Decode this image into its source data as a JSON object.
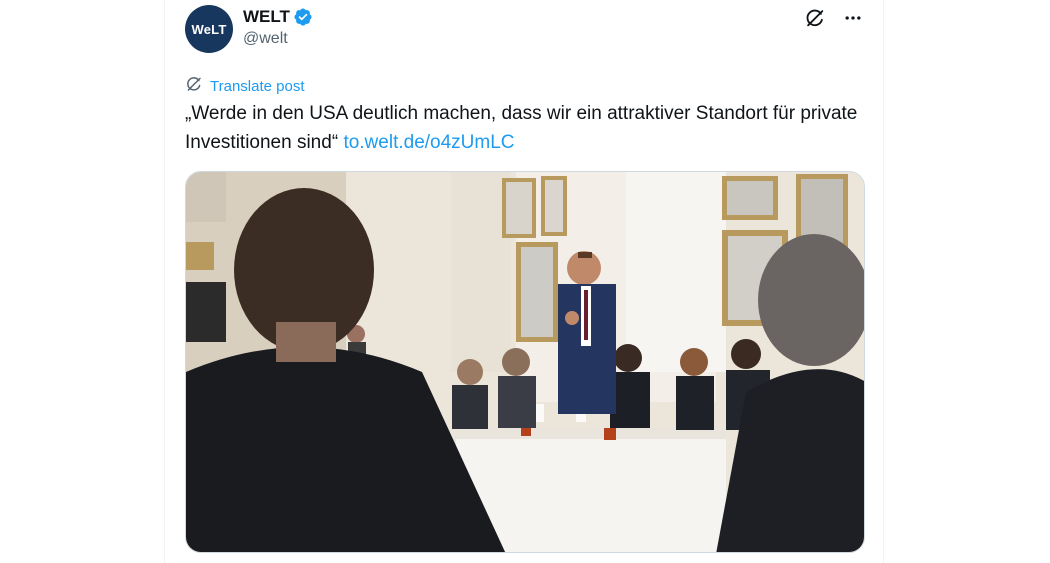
{
  "post": {
    "author": {
      "display_name": "WELT",
      "handle": "@welt",
      "avatar_text": "WeLT",
      "verified": true
    },
    "translate_label": "Translate post",
    "text": "„Werde in den USA deutlich machen, dass wir ein attraktiver Standort für private Investitionen sind“",
    "link_text": "to.welt.de/o4zUmLC",
    "icons": {
      "grok": "grok-icon",
      "more": "more-options-icon",
      "translate": "translate-icon",
      "verified": "verified-badge-icon"
    }
  },
  "colors": {
    "link": "#1d9bf0",
    "avatar_bg": "#18375f",
    "text": "#0f1419",
    "secondary_text": "#536471"
  }
}
